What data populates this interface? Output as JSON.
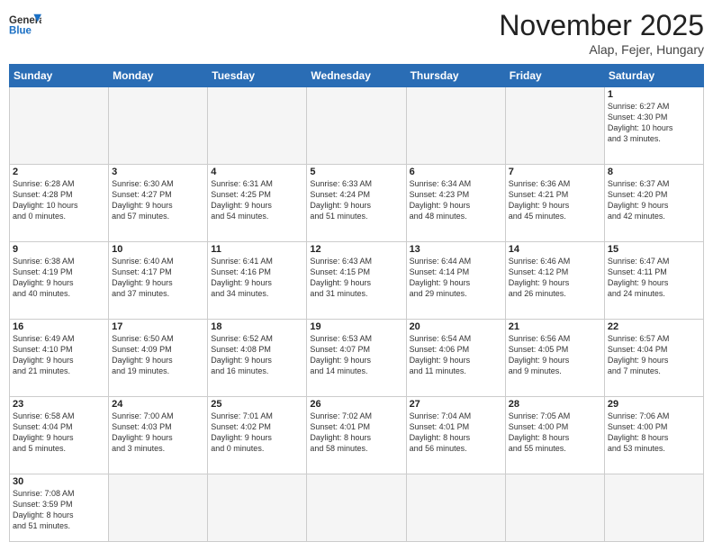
{
  "header": {
    "logo_line1": "General",
    "logo_line2": "Blue",
    "month_title": "November 2025",
    "location": "Alap, Fejer, Hungary"
  },
  "weekdays": [
    "Sunday",
    "Monday",
    "Tuesday",
    "Wednesday",
    "Thursday",
    "Friday",
    "Saturday"
  ],
  "weeks": [
    [
      {
        "day": "",
        "info": "",
        "empty": true
      },
      {
        "day": "",
        "info": "",
        "empty": true
      },
      {
        "day": "",
        "info": "",
        "empty": true
      },
      {
        "day": "",
        "info": "",
        "empty": true
      },
      {
        "day": "",
        "info": "",
        "empty": true
      },
      {
        "day": "",
        "info": "",
        "empty": true
      },
      {
        "day": "1",
        "info": "Sunrise: 6:27 AM\nSunset: 4:30 PM\nDaylight: 10 hours\nand 3 minutes."
      }
    ],
    [
      {
        "day": "2",
        "info": "Sunrise: 6:28 AM\nSunset: 4:28 PM\nDaylight: 10 hours\nand 0 minutes."
      },
      {
        "day": "3",
        "info": "Sunrise: 6:30 AM\nSunset: 4:27 PM\nDaylight: 9 hours\nand 57 minutes."
      },
      {
        "day": "4",
        "info": "Sunrise: 6:31 AM\nSunset: 4:25 PM\nDaylight: 9 hours\nand 54 minutes."
      },
      {
        "day": "5",
        "info": "Sunrise: 6:33 AM\nSunset: 4:24 PM\nDaylight: 9 hours\nand 51 minutes."
      },
      {
        "day": "6",
        "info": "Sunrise: 6:34 AM\nSunset: 4:23 PM\nDaylight: 9 hours\nand 48 minutes."
      },
      {
        "day": "7",
        "info": "Sunrise: 6:36 AM\nSunset: 4:21 PM\nDaylight: 9 hours\nand 45 minutes."
      },
      {
        "day": "8",
        "info": "Sunrise: 6:37 AM\nSunset: 4:20 PM\nDaylight: 9 hours\nand 42 minutes."
      }
    ],
    [
      {
        "day": "9",
        "info": "Sunrise: 6:38 AM\nSunset: 4:19 PM\nDaylight: 9 hours\nand 40 minutes."
      },
      {
        "day": "10",
        "info": "Sunrise: 6:40 AM\nSunset: 4:17 PM\nDaylight: 9 hours\nand 37 minutes."
      },
      {
        "day": "11",
        "info": "Sunrise: 6:41 AM\nSunset: 4:16 PM\nDaylight: 9 hours\nand 34 minutes."
      },
      {
        "day": "12",
        "info": "Sunrise: 6:43 AM\nSunset: 4:15 PM\nDaylight: 9 hours\nand 31 minutes."
      },
      {
        "day": "13",
        "info": "Sunrise: 6:44 AM\nSunset: 4:14 PM\nDaylight: 9 hours\nand 29 minutes."
      },
      {
        "day": "14",
        "info": "Sunrise: 6:46 AM\nSunset: 4:12 PM\nDaylight: 9 hours\nand 26 minutes."
      },
      {
        "day": "15",
        "info": "Sunrise: 6:47 AM\nSunset: 4:11 PM\nDaylight: 9 hours\nand 24 minutes."
      }
    ],
    [
      {
        "day": "16",
        "info": "Sunrise: 6:49 AM\nSunset: 4:10 PM\nDaylight: 9 hours\nand 21 minutes."
      },
      {
        "day": "17",
        "info": "Sunrise: 6:50 AM\nSunset: 4:09 PM\nDaylight: 9 hours\nand 19 minutes."
      },
      {
        "day": "18",
        "info": "Sunrise: 6:52 AM\nSunset: 4:08 PM\nDaylight: 9 hours\nand 16 minutes."
      },
      {
        "day": "19",
        "info": "Sunrise: 6:53 AM\nSunset: 4:07 PM\nDaylight: 9 hours\nand 14 minutes."
      },
      {
        "day": "20",
        "info": "Sunrise: 6:54 AM\nSunset: 4:06 PM\nDaylight: 9 hours\nand 11 minutes."
      },
      {
        "day": "21",
        "info": "Sunrise: 6:56 AM\nSunset: 4:05 PM\nDaylight: 9 hours\nand 9 minutes."
      },
      {
        "day": "22",
        "info": "Sunrise: 6:57 AM\nSunset: 4:04 PM\nDaylight: 9 hours\nand 7 minutes."
      }
    ],
    [
      {
        "day": "23",
        "info": "Sunrise: 6:58 AM\nSunset: 4:04 PM\nDaylight: 9 hours\nand 5 minutes."
      },
      {
        "day": "24",
        "info": "Sunrise: 7:00 AM\nSunset: 4:03 PM\nDaylight: 9 hours\nand 3 minutes."
      },
      {
        "day": "25",
        "info": "Sunrise: 7:01 AM\nSunset: 4:02 PM\nDaylight: 9 hours\nand 0 minutes."
      },
      {
        "day": "26",
        "info": "Sunrise: 7:02 AM\nSunset: 4:01 PM\nDaylight: 8 hours\nand 58 minutes."
      },
      {
        "day": "27",
        "info": "Sunrise: 7:04 AM\nSunset: 4:01 PM\nDaylight: 8 hours\nand 56 minutes."
      },
      {
        "day": "28",
        "info": "Sunrise: 7:05 AM\nSunset: 4:00 PM\nDaylight: 8 hours\nand 55 minutes."
      },
      {
        "day": "29",
        "info": "Sunrise: 7:06 AM\nSunset: 4:00 PM\nDaylight: 8 hours\nand 53 minutes."
      }
    ],
    [
      {
        "day": "30",
        "info": "Sunrise: 7:08 AM\nSunset: 3:59 PM\nDaylight: 8 hours\nand 51 minutes.",
        "last": true
      },
      {
        "day": "",
        "info": "",
        "empty": true,
        "last": true
      },
      {
        "day": "",
        "info": "",
        "empty": true,
        "last": true
      },
      {
        "day": "",
        "info": "",
        "empty": true,
        "last": true
      },
      {
        "day": "",
        "info": "",
        "empty": true,
        "last": true
      },
      {
        "day": "",
        "info": "",
        "empty": true,
        "last": true
      },
      {
        "day": "",
        "info": "",
        "empty": true,
        "last": true
      }
    ]
  ]
}
